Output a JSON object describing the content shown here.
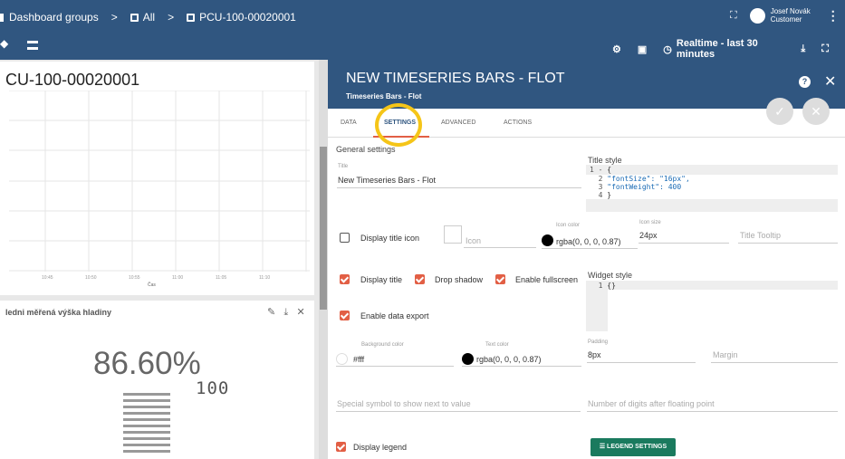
{
  "breadcrumbs": [
    "Dashboard groups",
    "All",
    "PCU-100-00020001"
  ],
  "user": {
    "name": "Josef Novák",
    "role": "Customer"
  },
  "toolbar": {
    "realtime_label": "Realtime - last 30 minutes"
  },
  "dashboard": {
    "widget1_title": "CU-100-00020001",
    "x_ticks": [
      "10:45",
      "10:50",
      "10:55",
      "11:00",
      "11:05",
      "11:10"
    ],
    "x_label": "Čas",
    "widget2_title": "ledni měřená výška hladiny",
    "gauge_value": "86.60%",
    "lcd_value": "100"
  },
  "panel": {
    "title": "NEW TIMESERIES BARS - FLOT",
    "subtitle": "Timeseries Bars - Flot",
    "tabs": [
      "DATA",
      "SETTINGS",
      "ADVANCED",
      "ACTIONS"
    ],
    "active_tab": "SETTINGS",
    "general_settings_label": "General settings",
    "title_field_label": "Title",
    "title_field_value": "New Timeseries Bars - Flot",
    "title_style_label": "Title style",
    "title_style_code": [
      {
        "ln": "1 -",
        "text": "{"
      },
      {
        "ln": "2",
        "text": "  \"fontSize\": \"16px\","
      },
      {
        "ln": "3",
        "text": "  \"fontWeight\": 400"
      },
      {
        "ln": "4",
        "text": "}"
      }
    ],
    "display_title_icon_label": "Display title icon",
    "icon_placeholder": "Icon",
    "icon_color_label": "Icon color",
    "icon_color_value": "rgba(0, 0, 0, 0.87)",
    "icon_size_label": "Icon size",
    "icon_size_value": "24px",
    "title_tooltip_placeholder": "Title Tooltip",
    "display_title_label": "Display title",
    "drop_shadow_label": "Drop shadow",
    "enable_fullscreen_label": "Enable fullscreen",
    "widget_style_label": "Widget style",
    "widget_style_code": [
      {
        "ln": "1",
        "text": "{}"
      }
    ],
    "enable_data_export_label": "Enable data export",
    "bg_color_label": "Background color",
    "bg_color_value": "#fff",
    "text_color_label": "Text color",
    "text_color_value": "rgba(0, 0, 0, 0.87)",
    "padding_label": "Padding",
    "padding_value": "8px",
    "margin_placeholder": "Margin",
    "special_symbol_placeholder": "Special symbol to show next to value",
    "digits_placeholder": "Number of digits after floating point",
    "display_legend_label": "Display legend",
    "legend_settings_label": "LEGEND SETTINGS"
  },
  "colors": {
    "primary": "#305680",
    "accent": "#e25f45",
    "highlight": "#f5c518",
    "legend_btn": "#1a7a5e"
  }
}
